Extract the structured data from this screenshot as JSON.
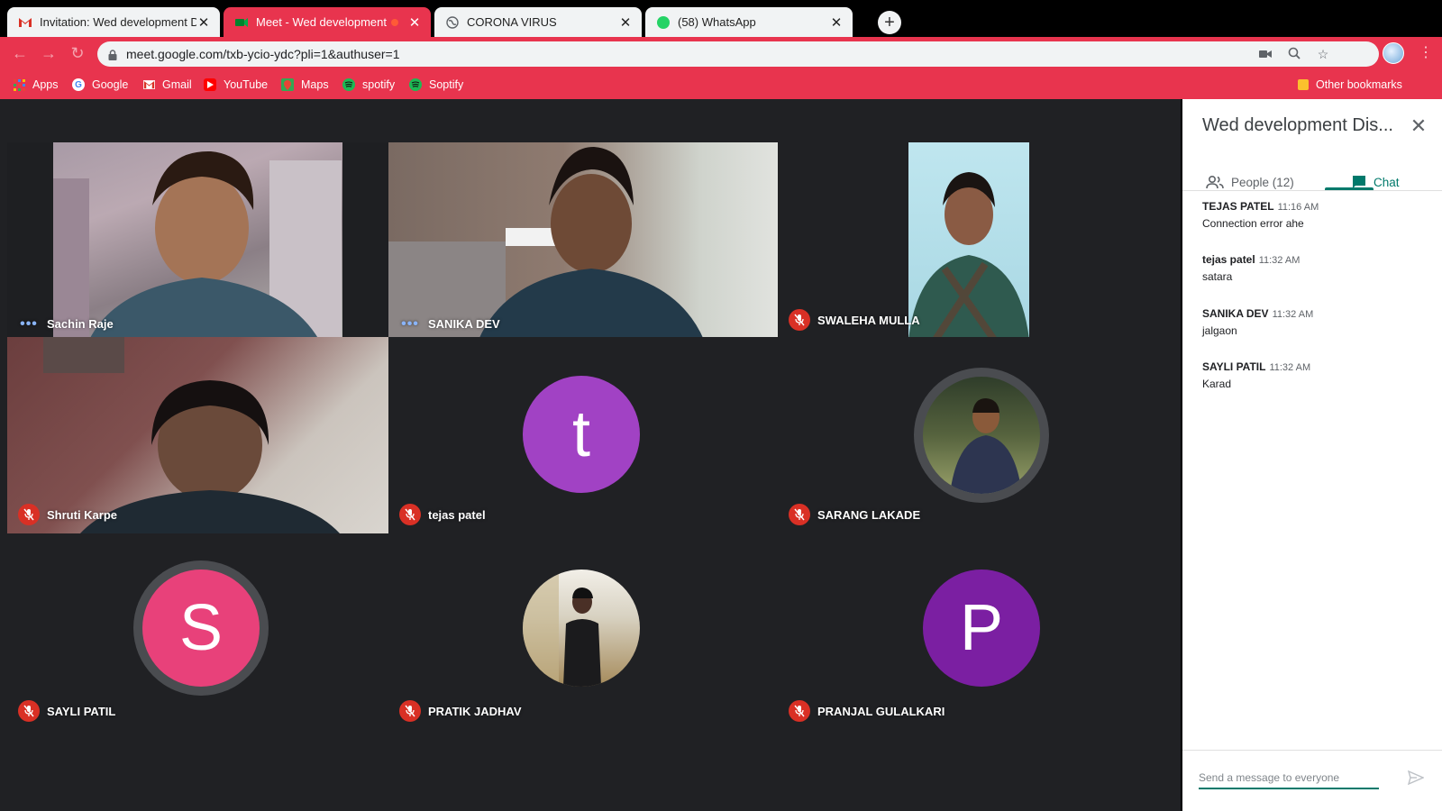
{
  "browser": {
    "tabs": [
      {
        "title": "Invitation: Wed development Dis",
        "favicon": "gmail-icon"
      },
      {
        "title": "Meet - Wed development D",
        "favicon": "meet-icon"
      },
      {
        "title": "CORONA VIRUS",
        "favicon": "globe-icon"
      },
      {
        "title": "(58) WhatsApp",
        "favicon": "whatsapp-icon",
        "badge": "58"
      }
    ],
    "active_tab": 1,
    "new_tab_label": "+",
    "url": "meet.google.com/txb-ycio-ydc?pli=1&authuser=1",
    "accent_color": "#e8344e"
  },
  "bookmarks": {
    "items": [
      {
        "label": "Apps",
        "icon": "apps-grid-icon"
      },
      {
        "label": "Google",
        "icon": "google-icon"
      },
      {
        "label": "Gmail",
        "icon": "gmail-icon"
      },
      {
        "label": "YouTube",
        "icon": "youtube-icon"
      },
      {
        "label": "Maps",
        "icon": "maps-icon"
      },
      {
        "label": "spotify",
        "icon": "spotify-icon"
      },
      {
        "label": "Soptify",
        "icon": "spotify-icon"
      }
    ],
    "other": "Other bookmarks"
  },
  "participants": [
    {
      "name": "Sachin Raje",
      "status": "speaking",
      "kind": "video"
    },
    {
      "name": "SANIKA DEV",
      "status": "speaking",
      "kind": "video"
    },
    {
      "name": "SWALEHA MULLA",
      "status": "muted",
      "kind": "video"
    },
    {
      "name": "Shruti Karpe",
      "status": "muted",
      "kind": "video"
    },
    {
      "name": "tejas patel",
      "status": "muted",
      "kind": "letter",
      "letter": "t",
      "color": "#a142c4"
    },
    {
      "name": "SARANG LAKADE",
      "status": "muted",
      "kind": "photo"
    },
    {
      "name": "SAYLI PATIL",
      "status": "muted",
      "kind": "letter",
      "letter": "S",
      "color": "#e8417a"
    },
    {
      "name": "PRATIK JADHAV",
      "status": "muted",
      "kind": "photo"
    },
    {
      "name": "PRANJAL GULALKARI",
      "status": "muted",
      "kind": "letter",
      "letter": "P",
      "color": "#7b1fa2"
    }
  ],
  "panel": {
    "title": "Wed development Dis...",
    "people_label": "People (12)",
    "chat_label": "Chat",
    "messages": [
      {
        "author": "TEJAS PATEL",
        "time": "11:16 AM",
        "text": "Connection error ahe"
      },
      {
        "author": "tejas patel",
        "time": "11:32 AM",
        "text": "satara"
      },
      {
        "author": "SANIKA DEV",
        "time": "11:32 AM",
        "text": "jalgaon"
      },
      {
        "author": "SAYLI PATIL",
        "time": "11:32 AM",
        "text": "Karad"
      }
    ],
    "composer_placeholder": "Send a message to everyone"
  }
}
